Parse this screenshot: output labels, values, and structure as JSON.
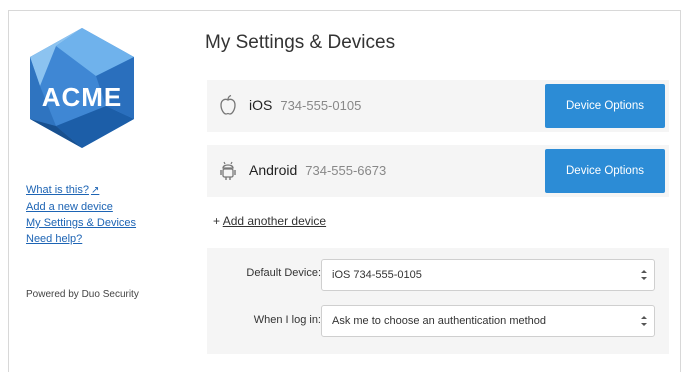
{
  "logo": {
    "text": "ACME",
    "colors": {
      "light": "#6fb2ec",
      "mid": "#3f87d4",
      "dark": "#1c5ea8"
    }
  },
  "sidebar": {
    "links": [
      {
        "label": "What is this?",
        "icon": "external-link-icon"
      },
      {
        "label": "Add a new device"
      },
      {
        "label": "My Settings & Devices"
      },
      {
        "label": "Need help?"
      }
    ],
    "powered_by": "Powered by Duo Security"
  },
  "main": {
    "title": "My Settings & Devices",
    "devices": [
      {
        "name": "iOS",
        "phone": "734-555-0105",
        "icon": "apple-icon",
        "button_label": "Device Options"
      },
      {
        "name": "Android",
        "phone": "734-555-6673",
        "icon": "android-icon",
        "button_label": "Device Options"
      }
    ],
    "add_another_prefix": "+",
    "add_another_label": "Add another device",
    "settings": {
      "default_device_label": "Default Device:",
      "default_device_value": "iOS 734-555-0105",
      "when_login_label": "When I log in:",
      "when_login_value": "Ask me to choose an authentication method"
    }
  },
  "colors": {
    "accent": "#2c8cd6",
    "link": "#1d64b4",
    "panel_bg": "#f5f5f5"
  }
}
